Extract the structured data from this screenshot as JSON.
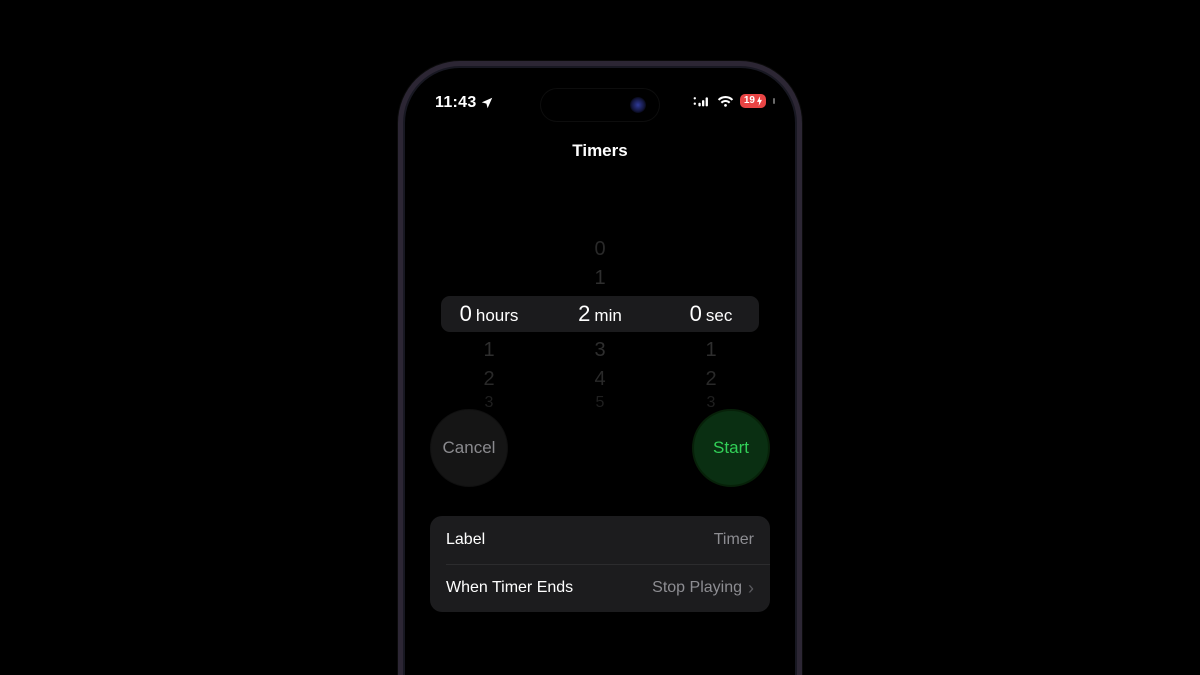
{
  "status": {
    "time": "11:43",
    "battery_percent": "19"
  },
  "nav": {
    "title": "Timers"
  },
  "picker": {
    "hours": {
      "selected": "0",
      "unit": "hours",
      "below": [
        "1",
        "2",
        "3"
      ]
    },
    "minutes": {
      "above": [
        "0",
        "1"
      ],
      "selected": "2",
      "unit": "min",
      "below": [
        "3",
        "4",
        "5"
      ]
    },
    "seconds": {
      "selected": "0",
      "unit": "sec",
      "below": [
        "1",
        "2",
        "3"
      ]
    }
  },
  "buttons": {
    "cancel": "Cancel",
    "start": "Start"
  },
  "settings": {
    "label": {
      "title": "Label",
      "value": "Timer"
    },
    "sound": {
      "title": "When Timer Ends",
      "value": "Stop Playing"
    }
  }
}
